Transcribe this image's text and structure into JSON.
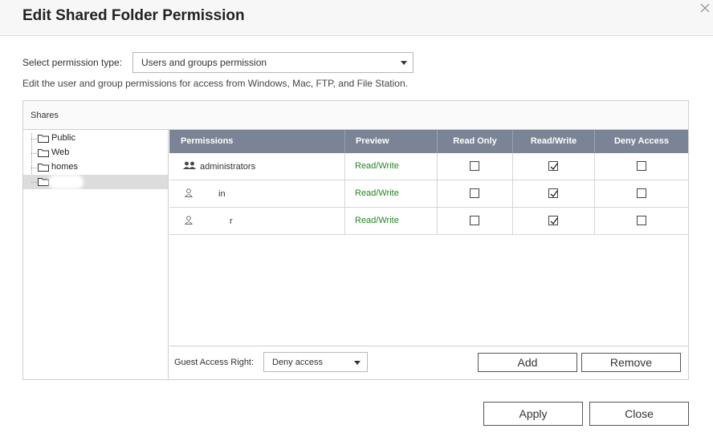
{
  "dialog": {
    "title": "Edit Shared Folder Permission",
    "perm_type_label": "Select permission type:",
    "perm_type_value": "Users and groups permission",
    "description": "Edit the user and group permissions for access from Windows, Mac, FTP, and File Station."
  },
  "shares": {
    "header": "Shares",
    "folders": [
      {
        "label": "Public"
      },
      {
        "label": "Web"
      },
      {
        "label": "homes"
      },
      {
        "label": ""
      }
    ]
  },
  "table": {
    "columns": [
      "Permissions",
      "Preview",
      "Read Only",
      "Read/Write",
      "Deny Access"
    ],
    "rows": [
      {
        "name": "administrators",
        "type": "group",
        "preview": "Read/Write",
        "read_only": false,
        "read_write": true,
        "deny": false
      },
      {
        "name": "in",
        "type": "user",
        "preview": "Read/Write",
        "read_only": false,
        "read_write": true,
        "deny": false
      },
      {
        "name": "r",
        "type": "user",
        "preview": "Read/Write",
        "read_only": false,
        "read_write": true,
        "deny": false
      }
    ]
  },
  "footer": {
    "guest_label": "Guest Access Right:",
    "guest_value": "Deny access",
    "add": "Add",
    "remove": "Remove"
  },
  "buttons": {
    "apply": "Apply",
    "close": "Close"
  },
  "icons": {
    "close": "close-icon",
    "folder": "folder-icon",
    "group": "group-icon",
    "user": "user-icon",
    "dropdown": "chevron-down-icon"
  },
  "colors": {
    "table_header": "#7b8494",
    "preview_text": "#1e8a1e",
    "selected_row": "#dcdcdc"
  }
}
